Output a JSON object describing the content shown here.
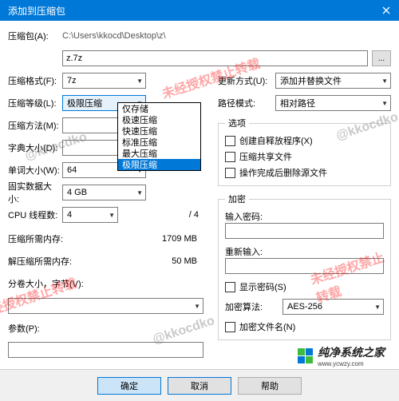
{
  "titlebar": {
    "title": "添加到压缩包"
  },
  "archive": {
    "label": "压缩包(A):",
    "pathPrefix": "C:\\Users\\kkocd\\Desktop\\z\\",
    "value": "z.7z",
    "browse": "..."
  },
  "left": {
    "format": {
      "label": "压缩格式(F):",
      "value": "7z"
    },
    "level": {
      "label": "压缩等级(L):",
      "value": "极限压缩",
      "options": [
        "仅存储",
        "极速压缩",
        "快速压缩",
        "标准压缩",
        "最大压缩",
        "极限压缩"
      ],
      "selectedIndex": 5
    },
    "method": {
      "label": "压缩方法(M):"
    },
    "dict": {
      "label": "字典大小(D):"
    },
    "word": {
      "label": "单词大小(W):",
      "value": "64"
    },
    "solid": {
      "label": "固实数据大小:",
      "value": "4 GB"
    },
    "cpu": {
      "label": "CPU 线程数:",
      "value": "4",
      "suffix": "/ 4"
    },
    "memC": {
      "label": "压缩所需内存:",
      "value": "1709 MB"
    },
    "memD": {
      "label": "解压缩所需内存:",
      "value": "50 MB"
    },
    "split": {
      "label": "分卷大小，字节(V):"
    },
    "params": {
      "label": "参数(P):"
    }
  },
  "right": {
    "update": {
      "label": "更新方式(U):",
      "value": "添加并替换文件"
    },
    "path": {
      "label": "路径模式:",
      "value": "相对路径"
    },
    "options": {
      "legend": "选项",
      "sfx": "创建自释放程序(X)",
      "share": "压缩共享文件",
      "del": "操作完成后删除源文件"
    },
    "enc": {
      "legend": "加密",
      "pwd": "输入密码:",
      "pwd2": "重新输入:",
      "show": "显示密码(S)",
      "algLabel": "加密算法:",
      "algValue": "AES-256",
      "encNames": "加密文件名(N)"
    }
  },
  "buttons": {
    "ok": "确定",
    "cancel": "取消",
    "help": "帮助"
  },
  "watermark": {
    "red": "未经授权禁止转载",
    "gray": "@kkocdko"
  },
  "branding": {
    "name": "纯净系统之家",
    "url": "www.ycwzy.com"
  }
}
